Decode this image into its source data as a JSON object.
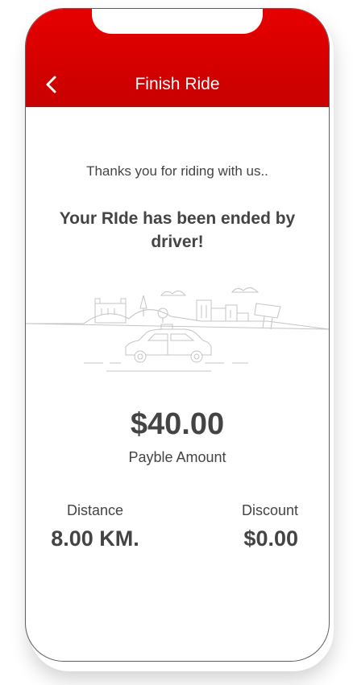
{
  "header": {
    "title": "Finish Ride",
    "back_icon": "chevron-left-icon",
    "background_color": "#d80000"
  },
  "message": {
    "thanks": "Thanks you for riding with us..",
    "ended": "Your RIde has been ended by driver!"
  },
  "illustration": {
    "icon": "city-taxi-illustration"
  },
  "payment": {
    "amount": "$40.00",
    "label": "Payble Amount"
  },
  "stats": {
    "distance_label": "Distance",
    "distance_value": "8.00 KM.",
    "discount_label": "Discount",
    "discount_value": "$0.00"
  }
}
